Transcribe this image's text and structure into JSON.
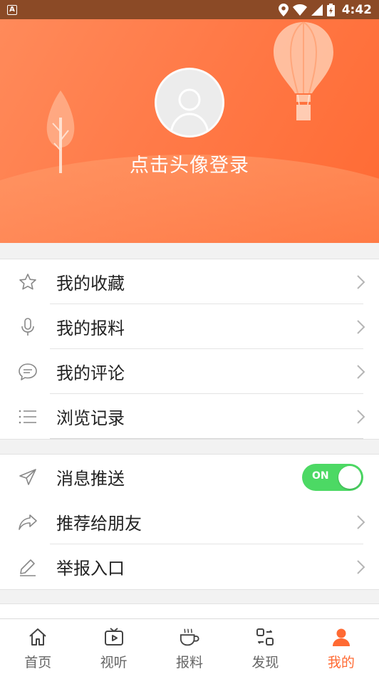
{
  "status_bar": {
    "app_badge": "A",
    "time": "4:42",
    "icons": [
      "location-icon",
      "wifi-icon",
      "signal-icon",
      "battery-charging-icon"
    ]
  },
  "header": {
    "login_prompt": "点击头像登录"
  },
  "group1": [
    {
      "label": "我的收藏",
      "icon": "star-icon"
    },
    {
      "label": "我的报料",
      "icon": "microphone-icon"
    },
    {
      "label": "我的评论",
      "icon": "comment-icon"
    },
    {
      "label": "浏览记录",
      "icon": "list-icon"
    }
  ],
  "group2": [
    {
      "label": "消息推送",
      "icon": "send-icon",
      "toggle": "ON"
    },
    {
      "label": "推荐给朋友",
      "icon": "share-icon"
    },
    {
      "label": "举报入口",
      "icon": "pencil-icon"
    }
  ],
  "bottom_nav": [
    {
      "label": "首页",
      "icon": "home-icon"
    },
    {
      "label": "视听",
      "icon": "tv-icon"
    },
    {
      "label": "报料",
      "icon": "cup-icon"
    },
    {
      "label": "发现",
      "icon": "discover-icon"
    },
    {
      "label": "我的",
      "icon": "person-icon",
      "active": true
    }
  ],
  "colors": {
    "accent": "#ff6a33",
    "toggle_on": "#4cd964"
  }
}
